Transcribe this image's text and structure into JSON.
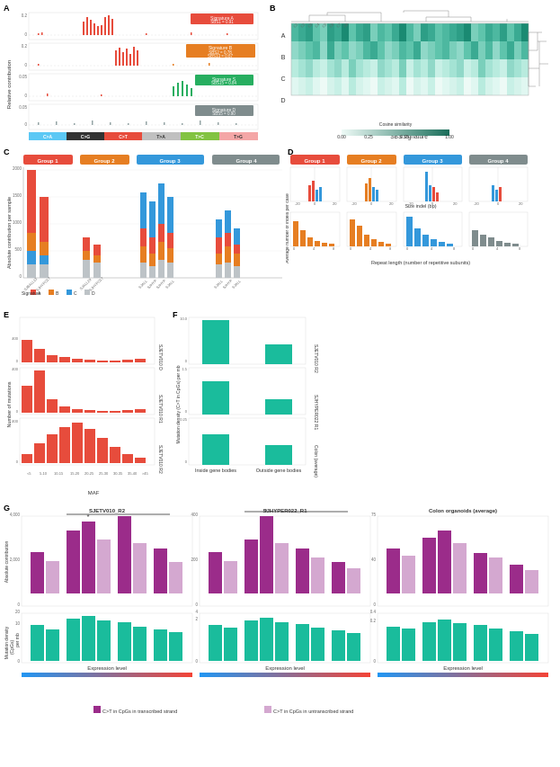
{
  "panels": {
    "a": {
      "label": "A",
      "y_axis_label": "Relative contribution",
      "signatures": [
        {
          "name": "Signature A",
          "sbs": "SBS1 = 0.91",
          "color": "#c0392b"
        },
        {
          "name": "Signature B",
          "sbs": "SBS2 = 0.78\nSBS13 = 0.67",
          "color": "#e67e22"
        },
        {
          "name": "Signature S",
          "sbs": "SBS15 = 0.84",
          "color": "#27ae60"
        },
        {
          "name": "Signature D",
          "sbs": "SBS5 = 0.90",
          "color": "#7f8c8d"
        }
      ],
      "mutation_types": [
        {
          "label": "C>A",
          "color": "#5bc8f5"
        },
        {
          "label": "C>G",
          "color": "#333333"
        },
        {
          "label": "C>T",
          "color": "#e74c3c"
        },
        {
          "label": "T>A",
          "color": "#c0c0c0"
        },
        {
          "label": "T>C",
          "color": "#82c341"
        },
        {
          "label": "T>G",
          "color": "#f4a6a6"
        }
      ]
    },
    "b": {
      "label": "B",
      "title": "SBS signature",
      "row_labels": [
        "A",
        "B",
        "C",
        "D"
      ],
      "colorbar": {
        "min": 0.0,
        "max": 1.0,
        "label": "Cosine similarity",
        "ticks": [
          0.0,
          0.25,
          0.75,
          1.0
        ]
      }
    },
    "c": {
      "label": "C",
      "y_axis_label": "Absolute contribution per sample",
      "x_label": "",
      "group_labels": [
        "Group 1",
        "Group 2",
        "Group 3",
        "Group 4"
      ],
      "signature_labels": [
        "A",
        "B",
        "C",
        "D"
      ],
      "signature_colors": [
        "#e74c3c",
        "#e67e22",
        "#3498db",
        "#bdc3c7"
      ]
    },
    "d": {
      "label": "D",
      "group_labels": [
        "Group 1",
        "Group 2",
        "Group 3",
        "Group 4"
      ],
      "top_x_label": "Size indel (bp)",
      "bottom_x_label": "Repeat length (number of repetitive subunits)",
      "top_y_label": "Average number of indels per case",
      "bottom_y_label": "Average number of indels per case"
    },
    "e": {
      "label": "E",
      "y_label": "Number of mutations",
      "x_label": "MAF",
      "x_ticks": [
        "<5",
        "5-10",
        "10-15",
        "15-20",
        "20-25",
        "25-30",
        "30-35",
        "35-40",
        "40-45",
        ">45"
      ],
      "samples": [
        {
          "name": "SJETV010 D",
          "color": "#e74c3c"
        },
        {
          "name": "SJETV010 R1",
          "color": "#e74c3c"
        },
        {
          "name": "SJETV010 R2",
          "color": "#e74c3c"
        }
      ]
    },
    "f": {
      "label": "F",
      "y_label": "Mutation density (C>T in CpGs) per mb",
      "x_label": "",
      "categories": [
        "Inside gene bodies",
        "Outside gene bodies"
      ],
      "samples": [
        {
          "name": "SJETV010 R2",
          "color": "#1abc9c"
        },
        {
          "name": "SJHYPER022 R1",
          "color": "#1abc9c"
        },
        {
          "name": "Colon (average)",
          "color": "#1abc9c"
        }
      ]
    },
    "g": {
      "label": "G",
      "panels": [
        {
          "title": "SJETV010_R2",
          "color1": "#9b2c8a",
          "color2": "#d4a8d0"
        },
        {
          "title": "SJHYPER022_R1",
          "color1": "#9b2c8a",
          "color2": "#d4a8d0"
        },
        {
          "title": "Colon organoids (average)",
          "color1": "#9b2c8a",
          "color2": "#d4a8d0"
        }
      ],
      "y_label_top": "Absolute contribution",
      "y_label_bottom": "Mutation density\n(CpGs)\nper mb",
      "x_label": "Expression level",
      "legend": [
        {
          "label": "C>T in CpGs in transcribed strand",
          "color": "#9b2c8a"
        },
        {
          "label": "C>T in CpGs in untranscribed strand",
          "color": "#d4a8d0"
        }
      ]
    }
  }
}
